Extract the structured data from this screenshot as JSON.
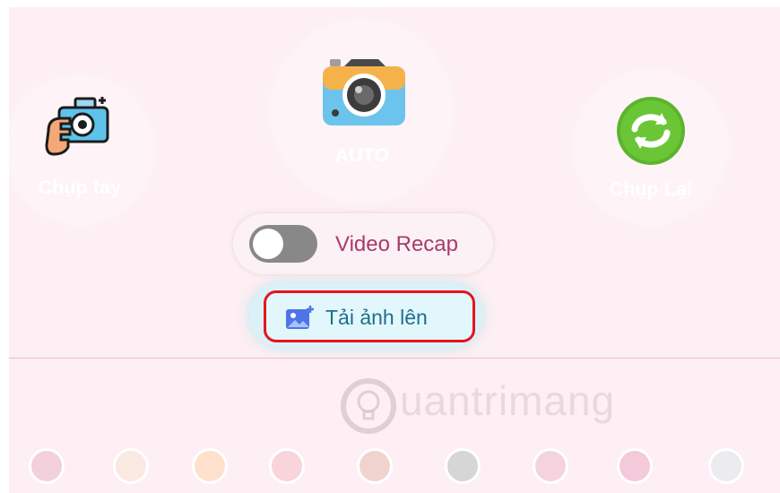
{
  "modes": {
    "manual": {
      "label": "Chụp tay",
      "icon": "hand-camera-icon"
    },
    "auto": {
      "label": "AUTO",
      "icon": "camera-icon"
    },
    "retake": {
      "label": "Chụp Lại",
      "icon": "refresh-icon"
    }
  },
  "video_recap": {
    "label": "Video Recap",
    "enabled": false
  },
  "upload": {
    "label": "Tải ảnh lên",
    "icon": "image-upload-icon"
  },
  "watermark": {
    "text": "uantrimang",
    "icon": "lightbulb-icon"
  },
  "colors": {
    "panel": "#fdeff3",
    "accent": "#a83b6a",
    "upload_text": "#1f6f8e",
    "highlight": "#e5141e",
    "swatches": [
      "#f3d1dc",
      "#fae9e1",
      "#fde1cc",
      "#f9d4da",
      "#f1d3cd",
      "#d6d6d6",
      "#f5d3de",
      "#f4c9da",
      "#ecebf0"
    ]
  }
}
